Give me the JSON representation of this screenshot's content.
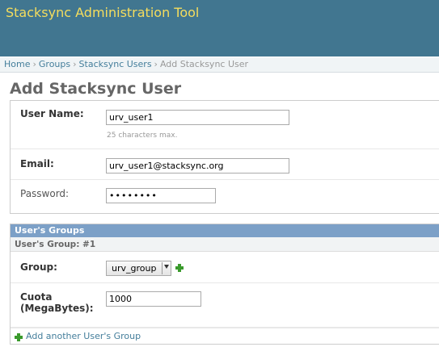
{
  "header": {
    "title": "Stacksync Administration Tool"
  },
  "breadcrumbs": {
    "home": "Home",
    "groups": "Groups",
    "users": "Stacksync Users",
    "current": "Add Stacksync User",
    "separator": "›"
  },
  "page_title": "Add Stacksync User",
  "user_form": {
    "username_label": "User Name:",
    "username_value": "urv_user1",
    "username_help": "25 characters max.",
    "email_label": "Email:",
    "email_value": "urv_user1@stacksync.org",
    "password_label": "Password:",
    "password_value": "••••••••"
  },
  "groups_module": {
    "title": "User's Groups",
    "inline_title": "User's Group: #1",
    "group_label": "Group:",
    "group_selected": "urv_group",
    "quota_label_line1": "Cuota",
    "quota_label_line2": "(MegaBytes):",
    "quota_value": "1000",
    "add_another": "Add another User's Group"
  },
  "colors": {
    "header_bg": "#417690",
    "title_text": "#f5dd5d",
    "module_header": "#7ca0c7",
    "link": "#447e9b",
    "add_icon": "#3a9a2c"
  },
  "icons": {
    "add_group": "plus-icon",
    "add_another": "plus-icon",
    "select": "chevron-down-icon"
  }
}
